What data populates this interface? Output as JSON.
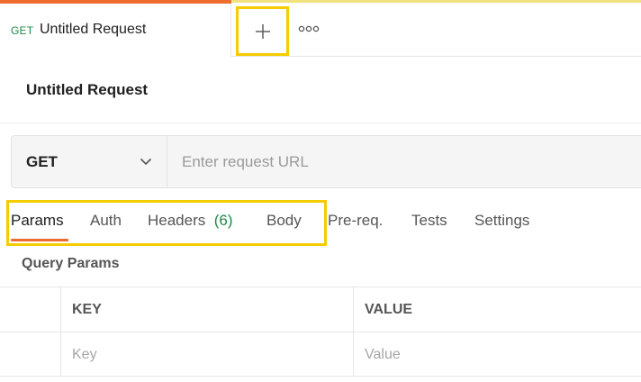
{
  "tabs": {
    "open": [
      {
        "method": "GET",
        "title": "Untitled Request"
      }
    ],
    "new_tab_icon": "plus-icon",
    "more_icon": "more-horizontal-icon"
  },
  "request": {
    "name": "Untitled Request",
    "method": "GET",
    "url": {
      "value": "",
      "placeholder": "Enter request URL"
    }
  },
  "request_tabs": [
    {
      "label": "Params",
      "active": true
    },
    {
      "label": "Auth"
    },
    {
      "label": "Headers",
      "count": "(6)"
    },
    {
      "label": "Body"
    },
    {
      "label": "Pre-req."
    },
    {
      "label": "Tests"
    },
    {
      "label": "Settings"
    }
  ],
  "query_params": {
    "title": "Query Params",
    "columns": [
      "KEY",
      "VALUE"
    ],
    "new_row": {
      "key_placeholder": "Key",
      "value_placeholder": "Value"
    }
  },
  "colors": {
    "accent": "#ef6c2f",
    "method_get": "#1f8a45",
    "highlight": "#f5cc00"
  }
}
